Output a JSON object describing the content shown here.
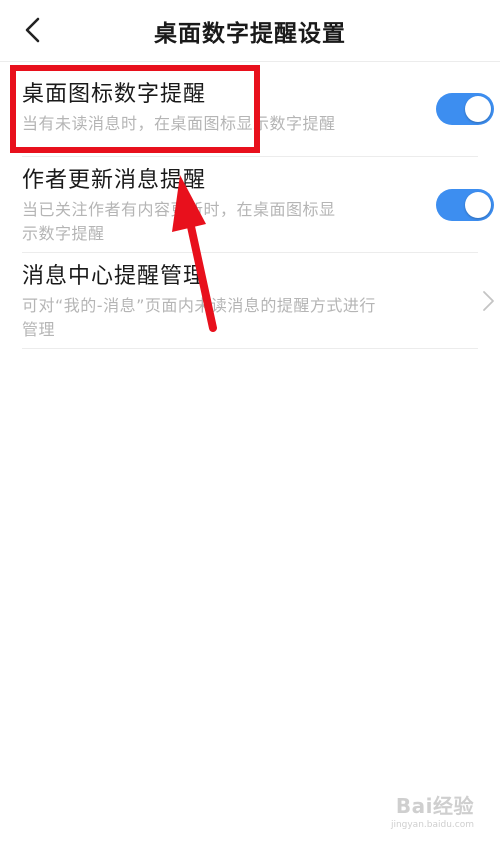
{
  "header": {
    "title": "桌面数字提醒设置",
    "back_icon": "chevron-left-icon"
  },
  "settings": [
    {
      "label": "桌面图标数字提醒",
      "desc_lines": [
        "当有未读消息时，在桌面图标显示数字提醒"
      ],
      "control": "toggle",
      "enabled": true
    },
    {
      "label": "作者更新消息提醒",
      "desc_lines": [
        "当已关注作者有内容更新时，在桌面图标显",
        "示数字提醒"
      ],
      "control": "toggle",
      "enabled": true
    },
    {
      "label": "消息中心提醒管理",
      "desc_lines": [
        "可对“我的-消息”页面内未读消息的提醒方式进行",
        "管理"
      ],
      "control": "chevron",
      "icon": "chevron-right-icon"
    }
  ],
  "colors": {
    "toggle_on": "#3d8ef0",
    "annotation_red": "#e8101c",
    "desc_text": "#b5b5b5"
  },
  "watermark": {
    "logo": "Bai经验",
    "url": "jingyan.baidu.com"
  }
}
